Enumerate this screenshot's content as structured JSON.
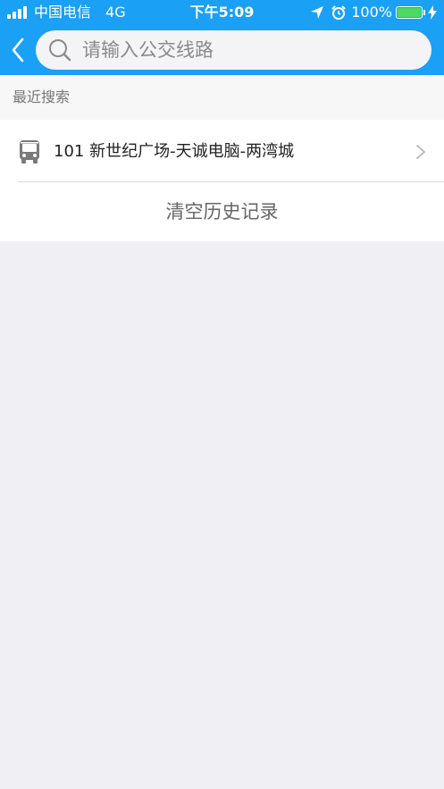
{
  "status_bar": {
    "carrier": "中国电信",
    "network": "4G",
    "time": "下午5:09",
    "battery_percent": "100%",
    "battery_level": 1.0,
    "battery_color": "#4cd964",
    "icons": [
      "signal-icon",
      "location-arrow-icon",
      "alarm-icon",
      "battery-icon",
      "charging-bolt-icon"
    ]
  },
  "header": {
    "background_color": "#1aa0f5",
    "back_icon": "chevron-left-icon",
    "search": {
      "icon": "search-icon",
      "value": "",
      "placeholder": "请输入公交线路"
    }
  },
  "recent": {
    "title": "最近搜索",
    "items": [
      {
        "icon": "bus-icon",
        "text": "101 新世纪广场-天诚电脑-两湾城",
        "trailing_icon": "chevron-right-icon"
      }
    ],
    "clear_label": "清空历史记录"
  }
}
